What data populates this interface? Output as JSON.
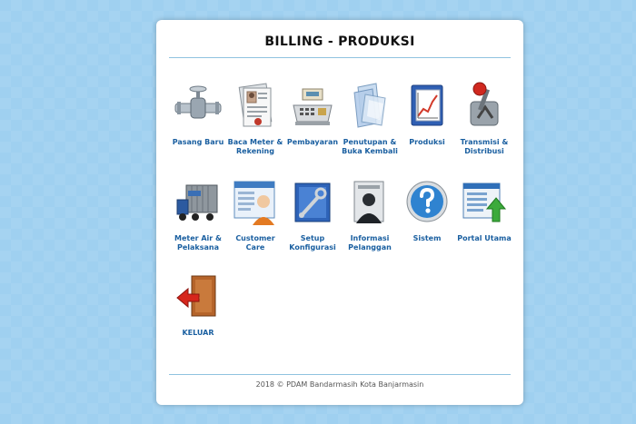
{
  "header": {
    "title": "BILLING - PRODUKSI"
  },
  "menu": [
    {
      "label": "Pasang Baru",
      "icon": "valve-icon"
    },
    {
      "label": "Baca Meter & Rekening",
      "icon": "document-person-icon"
    },
    {
      "label": "Pembayaran",
      "icon": "cash-register-icon"
    },
    {
      "label": "Penutupan & Buka Kembali",
      "icon": "folders-icon"
    },
    {
      "label": "Produksi",
      "icon": "chart-book-icon"
    },
    {
      "label": "Transmisi & Distribusi",
      "icon": "lever-icon"
    },
    {
      "label": "Meter Air & Pelaksana",
      "icon": "truck-icon"
    },
    {
      "label": "Customer Care",
      "icon": "customer-form-icon"
    },
    {
      "label": "Setup Konfigurasi",
      "icon": "wrench-box-icon"
    },
    {
      "label": "Informasi Pelanggan",
      "icon": "user-profile-icon"
    },
    {
      "label": "Sistem",
      "icon": "help-icon"
    },
    {
      "label": "Portal Utama",
      "icon": "portal-upload-icon"
    },
    {
      "label": "KELUAR",
      "icon": "exit-door-icon"
    }
  ],
  "footer": {
    "text": "2018 © PDAM Bandarmasih Kota Banjarmasin"
  }
}
